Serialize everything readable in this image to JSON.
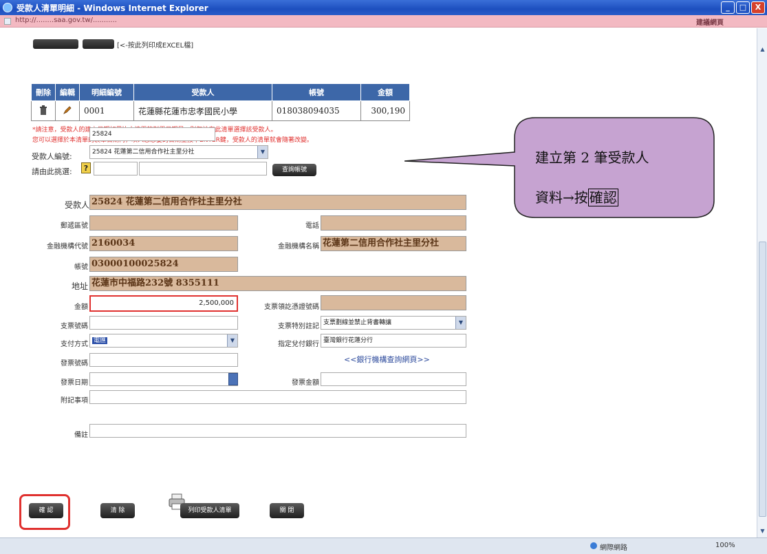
{
  "window": {
    "title": "受款人清單明細 - Windows Internet Explorer",
    "url": "http://........saa.gov.tw/...........",
    "right_label": "建議網頁",
    "buttons": [
      "_",
      "□",
      "X"
    ]
  },
  "excel_note": "[<-按此列印成EXCEL檔]",
  "table": {
    "headers": [
      "刪除",
      "編輯",
      "明細編號",
      "受款人",
      "帳號",
      "金額"
    ],
    "rows": [
      {
        "id": "0001",
        "payee": "花蓮縣花蓮市忠孝國民小學",
        "account": "018038094035",
        "amount": "300,190"
      }
    ]
  },
  "notes": [
    "*請注意，受款人的建立日期如果比本清單的製單日期早，則無法在此清單選擇該受款人。",
    "您可以選擇於本清單的製單日期內，填入您想要的日期並按下ENTER鍵，受款人的清單就會隨著改變。"
  ],
  "payee_id": {
    "label": "受款人編號:",
    "value": "25824"
  },
  "bank_select": {
    "label": "請由此挑選:",
    "value": "25824 花蓮第二信用合作社主里分社"
  },
  "query_button": "查詢帳號",
  "help_icon": "?",
  "form": {
    "payee_label": "受款人",
    "payee_value": "25824 花蓮第二信用合作社主里分社",
    "postal_label": "郵遞區號",
    "phone_label": "電話",
    "bank_code_label": "金融機構代號",
    "bank_code_value": "2160034",
    "bank_name_label": "金融機構名稱",
    "bank_name_value": "花蓮第二信用合作社主里分社",
    "account_label": "帳號",
    "account_value": "03000100025824",
    "address_label": "地址",
    "address_value": "花蓮市中福路232號 8355111",
    "amount_label": "金額",
    "amount_value": "2,500,000",
    "cheque_cert_label": "支票領訖憑證號碼",
    "cheque_no_label": "支票號碼",
    "cheque_special_label": "支票特別註記",
    "cheque_special_value": "支票劃線並禁止背書轉讓",
    "pay_method_label": "支付方式",
    "pay_method_value": "電匯",
    "designated_bank_label": "指定兌付銀行",
    "designated_bank_value": "臺灣銀行花蓮分行",
    "bank_list_link": "<<銀行機構查詢網頁>>",
    "invoice_no_label": "發票號碼",
    "invoice_date_label": "發票日期",
    "invoice_amount_label": "發票金額",
    "remarks_label": "附記事項",
    "memo_label": "備註"
  },
  "bottom_buttons": {
    "confirm": "確 認",
    "clear": "清 除",
    "print": "列印受款人清單",
    "close": "關 閉"
  },
  "callout": {
    "line1": "建立第 2 筆受款人",
    "line2_prefix": "資料→按",
    "line2_boxed": "確認"
  },
  "status": {
    "zone": "網際網路",
    "zoom": "100%"
  },
  "colors": {
    "header_blue": "#3d67a8",
    "field_tan": "#d9b99c",
    "callout_purple": "#c6a3d1",
    "highlight_red": "#e0312f"
  }
}
